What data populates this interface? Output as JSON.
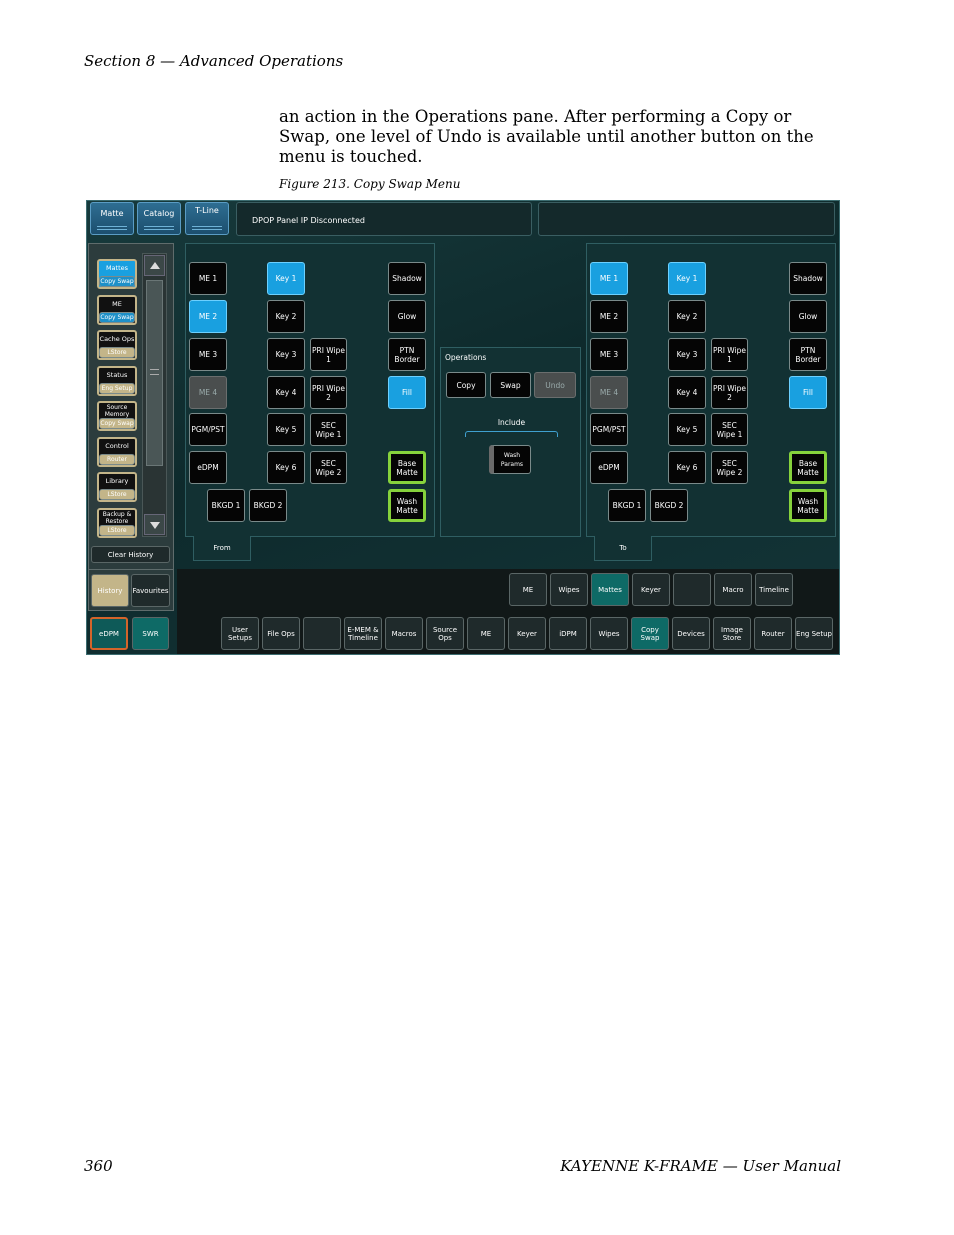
{
  "header": {
    "section": "Section 8 — Advanced Operations"
  },
  "body_text": "an action in the Operations pane. After performing a Copy or Swap, one level of Undo is available until another button on the menu is touched.",
  "figure_caption": "Figure 213.  Copy Swap Menu",
  "footer": {
    "page_number": "360",
    "title": "KAYENNE K-FRAME  —  User Manual"
  },
  "screen": {
    "top_tabs": [
      "Matte",
      "Catalog",
      "T-Line"
    ],
    "message": "DPOP Panel IP Disconnected",
    "history_items": [
      {
        "top": "Mattes",
        "bottom": "Copy Swap"
      },
      {
        "top": "ME",
        "bottom": "Copy Swap"
      },
      {
        "top": "Cache Ops",
        "bottom": "LStore"
      },
      {
        "top": "Status",
        "bottom": "Eng  Setup"
      },
      {
        "top": "Source Memory",
        "bottom": "Copy Swap"
      },
      {
        "top": "Control",
        "bottom": "Router"
      },
      {
        "top": "Library",
        "bottom": "LStore"
      },
      {
        "top": "Backup & Restore",
        "bottom": "LStore"
      }
    ],
    "clear_history": "Clear History",
    "history_tab": "History",
    "favourites_tab": "Favourites",
    "edpm": "eDPM",
    "swr": "SWR",
    "from_panel": {
      "tab_label": "From",
      "me": [
        "ME 1",
        "ME 2",
        "ME 3",
        "ME 4",
        "PGM/PST",
        "eDPM"
      ],
      "keys": [
        "Key 1",
        "Key 2",
        "Key 3",
        "Key 4",
        "Key 5",
        "Key 6"
      ],
      "wipes": [
        "PRI Wipe 1",
        "PRI Wipe 2",
        "SEC Wipe 1",
        "SEC Wipe 2"
      ],
      "right": [
        "Shadow",
        "Glow",
        "PTN Border",
        "Fill",
        "Base Matte",
        "Wash Matte"
      ],
      "bkgd": [
        "BKGD 1",
        "BKGD 2"
      ],
      "selected": [
        "ME 2",
        "Key 1",
        "Fill"
      ]
    },
    "to_panel": {
      "tab_label": "To",
      "me": [
        "ME 1",
        "ME 2",
        "ME 3",
        "ME 4",
        "PGM/PST",
        "eDPM"
      ],
      "keys": [
        "Key 1",
        "Key 2",
        "Key 3",
        "Key 4",
        "Key 5",
        "Key 6"
      ],
      "wipes": [
        "PRI Wipe 1",
        "PRI Wipe 2",
        "SEC Wipe 1",
        "SEC Wipe 2"
      ],
      "right": [
        "Shadow",
        "Glow",
        "PTN Border",
        "Fill",
        "Base Matte",
        "Wash Matte"
      ],
      "bkgd": [
        "BKGD 1",
        "BKGD 2"
      ],
      "selected": [
        "ME 1",
        "Key 1",
        "Fill"
      ]
    },
    "operations": {
      "title": "Operations",
      "copy": "Copy",
      "swap": "Swap",
      "undo": "Undo",
      "include_label": "Include",
      "wash_params": "Wash Params"
    },
    "submenu": [
      "ME",
      "Wipes",
      "Mattes",
      "Keyer",
      "",
      "Macro",
      "Timeline"
    ],
    "submenu_selected": "Mattes",
    "nav": [
      "User Setups",
      "File Ops",
      "",
      "E-MEM & Timeline",
      "Macros",
      "Source Ops",
      "ME",
      "Keyer",
      "iDPM",
      "Wipes",
      "Copy Swap",
      "Devices",
      "Image Store",
      "Router",
      "Eng Setup"
    ],
    "nav_selected": "Copy Swap",
    "colors": {
      "selected_blue": "#19a0e0",
      "teal_selected": "#0e6a66",
      "green_border": "#86d23c",
      "history_tan": "#c3b589",
      "edpm_orange": "#d4642a"
    }
  }
}
